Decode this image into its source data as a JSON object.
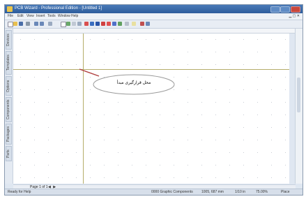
{
  "window": {
    "title": "PCB Wizard - Professional Edition - [Untitled 1]"
  },
  "menu": {
    "items": [
      "File",
      "Edit",
      "View",
      "Insert",
      "Tools",
      "Window",
      "Help"
    ]
  },
  "side_tabs": [
    "Devices",
    "Templates",
    "Options",
    "Components",
    "Packages",
    "Parts"
  ],
  "canvas": {
    "callout_text": "محل قرارگیری مبدأ"
  },
  "pagebar": {
    "page_label": "Page 1 of 1"
  },
  "statusbar": {
    "left_text": "Ready for Help",
    "mid_text": "0000 Graphic Components",
    "coords": "1005, 687 mm",
    "zoom": "1/10 in",
    "percent": "75.00%",
    "mode": "Place"
  },
  "colors": {
    "title_bar": "#2d5d9c",
    "guide_line": "#b5ad6a"
  }
}
